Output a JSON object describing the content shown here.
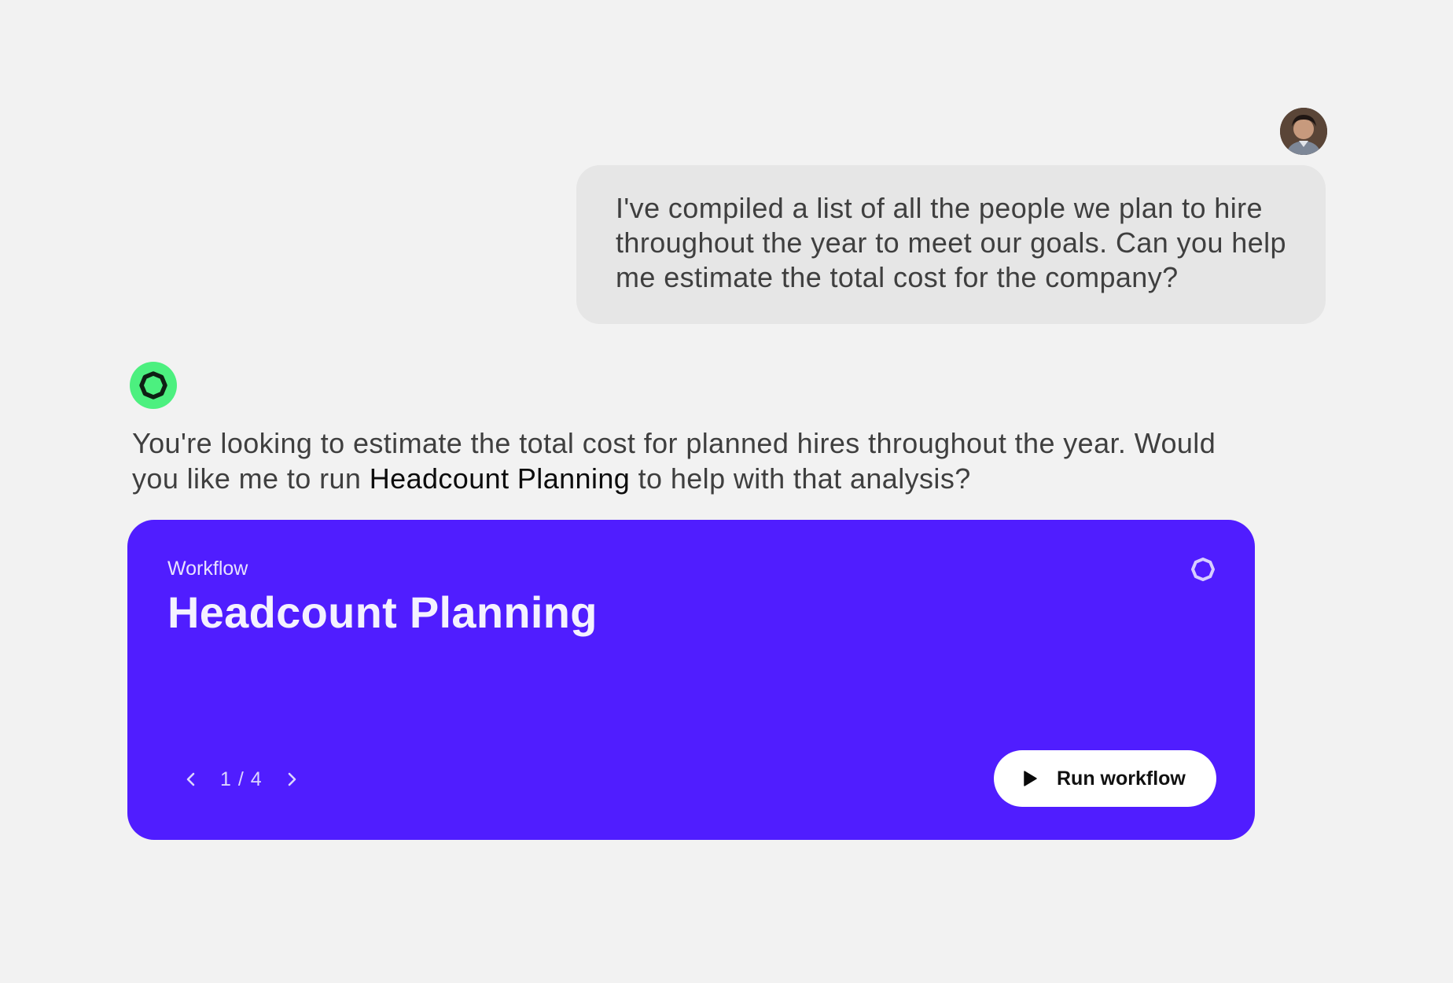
{
  "user": {
    "avatar_icon": "user-avatar-photo",
    "message": "I've compiled a list of all the people we plan to hire throughout the year to meet our goals. Can you help me estimate the total cost for the company?"
  },
  "assistant": {
    "icon": "assistant-ring-icon",
    "message_part1": "You're looking to estimate the total cost for planned hires throughout the year. Would you like me to run ",
    "message_highlight": "Headcount Planning",
    "message_part2": " to help with that analysis?"
  },
  "workflow_card": {
    "kicker": "Workflow",
    "title": "Headcount Planning",
    "pager_text": "1 / 4",
    "run_label": "Run workflow",
    "accent_color": "#501dff"
  },
  "colors": {
    "background": "#f2f2f2",
    "user_bubble": "#e6e6e6",
    "assistant_icon": "#4cf07f"
  }
}
